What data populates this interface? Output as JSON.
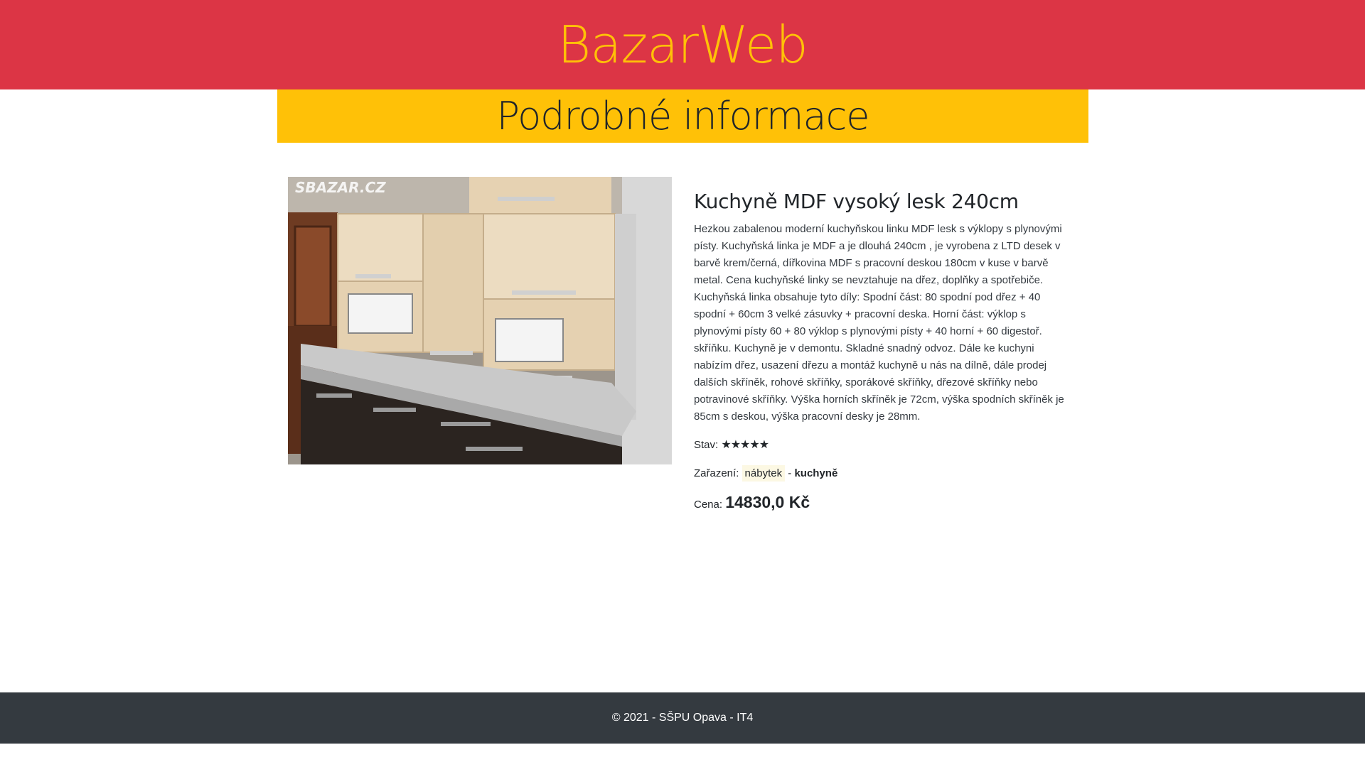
{
  "header": {
    "brand": "BazarWeb"
  },
  "subheader": {
    "title": "Podrobné informace"
  },
  "item": {
    "image_watermark": "SBAZAR.CZ",
    "title": "Kuchyně MDF vysoký lesk 240cm",
    "description": "Hezkou zabalenou moderní kuchyňskou linku MDF lesk s výklopy s plynovými písty. Kuchyňská linka je MDF a je dlouhá 240cm , je vyrobena z LTD desek v barvě krem/černá, dířkovina MDF s pracovní deskou 180cm v kuse v barvě metal. Cena kuchyňské linky se nevztahuje na dřez, doplňky a spotřebiče. Kuchyňská linka obsahuje tyto díly: Spodní část: 80 spodní pod dřez + 40 spodní + 60cm 3 velké zásuvky + pracovní deska. Horní část: výklop s plynovými písty 60 + 80 výklop s plynovými písty + 40 horní + 60 digestoř. skříňku. Kuchyně je v demontu. Skladné snadný odvoz. Dále ke kuchyni nabízím dřez, usazení dřezu a montáž kuchyně u nás na dílně, dále prodej dalších skříněk, rohové skříňky, sporákové skříňky, dřezové skříňky nebo potravinové skříňky. Výška horních skříněk je 72cm, výška spodních skříněk je 85cm s deskou, výška pracovní desky je 28mm.",
    "condition_label": "Stav:",
    "condition_stars": "★★★★★",
    "condition_rating": 5,
    "category_label": "Zařazení:",
    "category": "nábytek",
    "category_separator": "-",
    "subcategory": "kuchyně",
    "price_label": "Cena:",
    "price": "14830,0 Kč"
  },
  "footer": {
    "text": "© 2021 - SŠPU Opava - IT4"
  },
  "colors": {
    "header_bg": "#dc3545",
    "brand": "#ffc107",
    "subheader_bg": "#ffc107",
    "footer_bg": "#343a40"
  }
}
